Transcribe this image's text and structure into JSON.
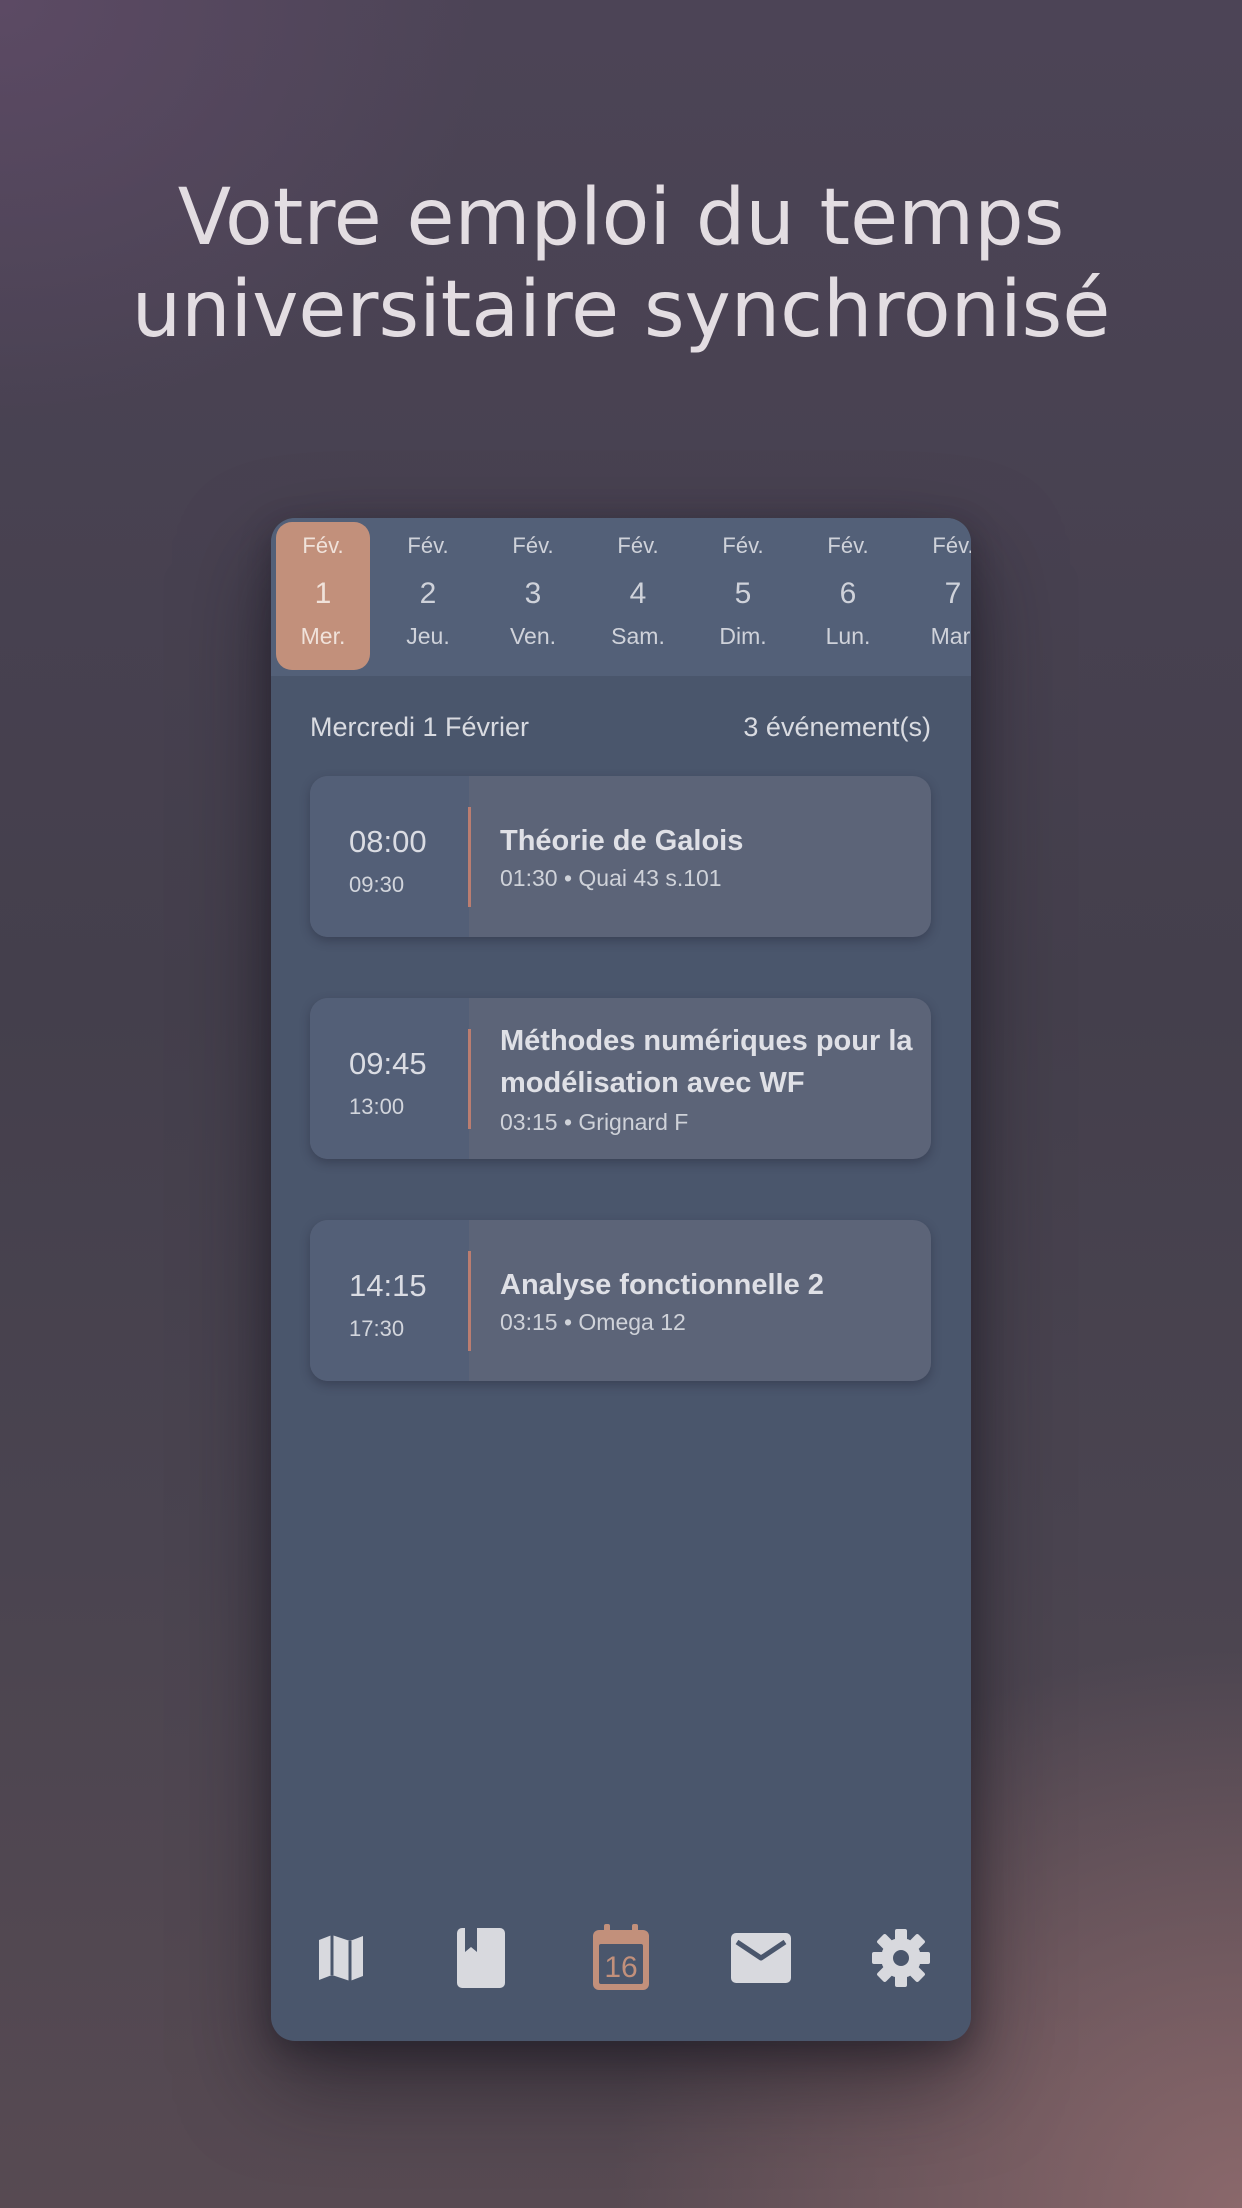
{
  "hero": {
    "line1": "Votre emploi du temps",
    "line2": "universitaire synchronisé"
  },
  "days": [
    {
      "month": "Fév.",
      "num": "1",
      "weekday": "Mer.",
      "selected": true
    },
    {
      "month": "Fév.",
      "num": "2",
      "weekday": "Jeu."
    },
    {
      "month": "Fév.",
      "num": "3",
      "weekday": "Ven."
    },
    {
      "month": "Fév.",
      "num": "4",
      "weekday": "Sam."
    },
    {
      "month": "Fév.",
      "num": "5",
      "weekday": "Dim."
    },
    {
      "month": "Fév.",
      "num": "6",
      "weekday": "Lun."
    },
    {
      "month": "Fév.",
      "num": "7",
      "weekday": "Mar."
    }
  ],
  "day_header": {
    "date": "Mercredi 1 Février",
    "count": "3 événement(s)"
  },
  "events": [
    {
      "start": "08:00",
      "end": "09:30",
      "title": "Théorie de Galois",
      "meta": "01:30 • Quai 43 s.101"
    },
    {
      "start": "09:45",
      "end": "13:00",
      "title": "Méthodes numériques pour la modélisation avec WF",
      "meta": "03:15 • Grignard F"
    },
    {
      "start": "14:15",
      "end": "17:30",
      "title": "Analyse fonctionnelle 2",
      "meta": "03:15 • Omega 12"
    }
  ],
  "nav": {
    "items": [
      {
        "icon": "map-icon"
      },
      {
        "icon": "book-icon"
      },
      {
        "icon": "calendar-icon",
        "day": "16",
        "active": true
      },
      {
        "icon": "mail-icon"
      },
      {
        "icon": "gear-icon"
      }
    ]
  },
  "colors": {
    "accent": "#c2907b",
    "card": "#5c6478",
    "panel": "#4a566c",
    "icon": "#d8d9de"
  }
}
